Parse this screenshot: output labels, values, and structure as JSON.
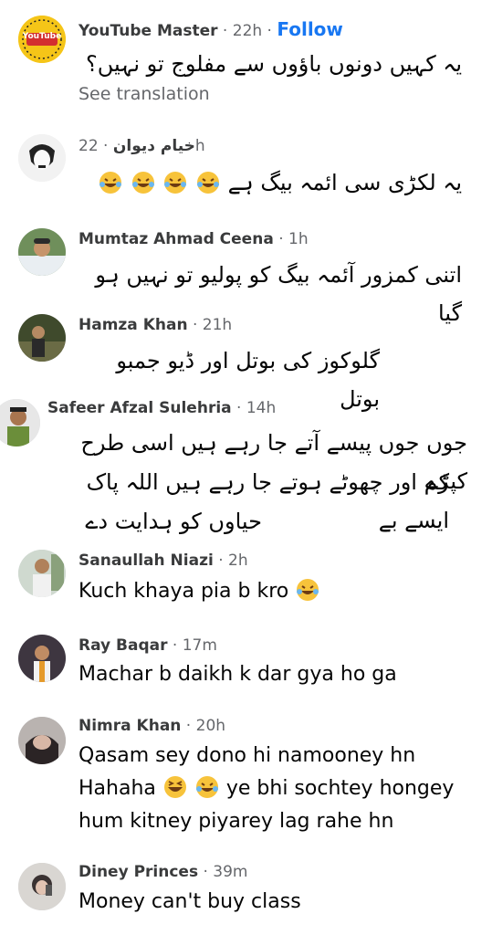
{
  "comments": [
    {
      "name": "YouTube Master",
      "time": "22h",
      "follow": "Follow",
      "body": "یہ کہیں دونوں باؤوں سے مفلوج تو نہیں؟",
      "see_translation": "See translation",
      "avatar_text": "YouTube"
    },
    {
      "name": "خیام دیوان",
      "time": "22h",
      "body": "یہ لکڑی سی ائمہ بیگ ہے"
    },
    {
      "name": "Mumtaz Ahmad Ceena",
      "time": "1h",
      "body": "اتنی کمزور آئمہ بیگ کو پولیو تو نہیں ہو گیا"
    },
    {
      "name": "Hamza Khan",
      "time": "21h",
      "body": "گلوکوز کی بوتل اور ڈیو جمبو بوتل"
    },
    {
      "name": "Safeer Afzal Sulehria",
      "time": "14h",
      "body_lines": [
        "جوں جوں پیسے آتے جا رہے ہیں اسی طرح کپڑے",
        "کم اور چھوٹے ہوتے جا رہے ہیں  اللہ پاک ایسے بے",
        "حیاوں کو ہدایت دے"
      ]
    },
    {
      "name": "Sanaullah Niazi",
      "time": "2h",
      "body": "Kuch khaya pia b kro"
    },
    {
      "name": "Ray Baqar",
      "time": "17m",
      "body": "Machar b daikh k dar gya ho ga"
    },
    {
      "name": "Nimra Khan",
      "time": "20h",
      "body_lines": [
        "Qasam sey dono hi namooney hn",
        "Hahaha",
        "ye bhi sochtey hongey",
        "hum kitney piyarey lag rahe hn"
      ]
    },
    {
      "name": "Diney Princes",
      "time": "39m",
      "body": "Money can't buy class"
    }
  ],
  "separator": " · ",
  "colors": {
    "name": "#3a3b3c",
    "meta": "#65676b",
    "link": "#1877f2",
    "emoji": "#f7c33b"
  },
  "emojis": {
    "laugh_tears": "face-with-tears-of-joy",
    "grin_squint": "grinning-squinting-face"
  }
}
